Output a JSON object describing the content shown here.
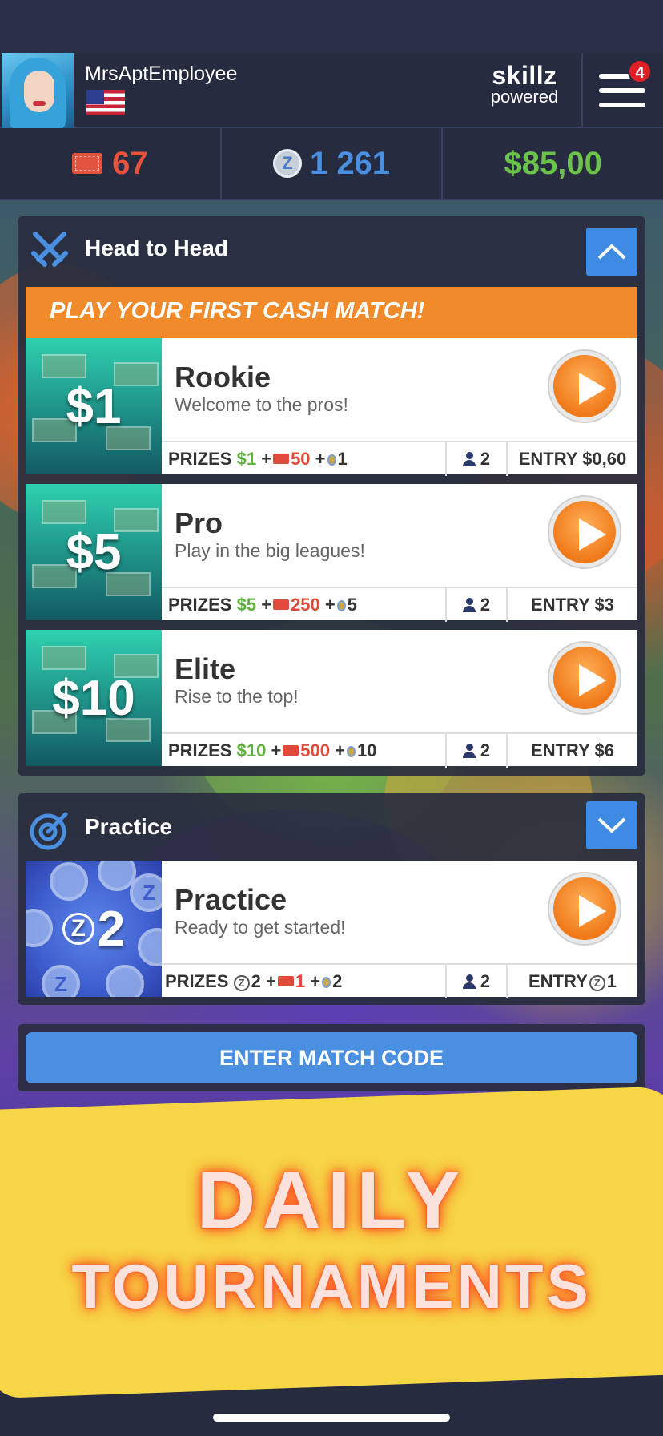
{
  "header": {
    "username": "MrsAptEmployee",
    "brand_top": "skillz",
    "brand_bottom": "powered",
    "notification_count": "4"
  },
  "currencies": {
    "tickets": "67",
    "z": "1 261",
    "cash": "$85,00"
  },
  "head_to_head": {
    "title": "Head to Head",
    "banner": "PLAY YOUR FIRST CASH MATCH!",
    "cards": [
      {
        "amount": "$1",
        "name": "Rookie",
        "desc": "Welcome to the pros!",
        "prize_cash": "$1",
        "prize_tickets": "50",
        "prize_medals": "1",
        "players": "2",
        "entry": "ENTRY $0,60"
      },
      {
        "amount": "$5",
        "name": "Pro",
        "desc": "Play in the big leagues!",
        "prize_cash": "$5",
        "prize_tickets": "250",
        "prize_medals": "5",
        "players": "2",
        "entry": "ENTRY $3"
      },
      {
        "amount": "$10",
        "name": "Elite",
        "desc": "Rise to the top!",
        "prize_cash": "$10",
        "prize_tickets": "500",
        "prize_medals": "10",
        "players": "2",
        "entry": "ENTRY $6"
      }
    ]
  },
  "practice": {
    "title": "Practice",
    "card": {
      "amount": "2",
      "name": "Practice",
      "desc": "Ready to get started!",
      "prize_z": "2",
      "prize_tickets": "1",
      "prize_medals": "2",
      "players": "2",
      "entry_label": "ENTRY",
      "entry_value": "1"
    }
  },
  "labels": {
    "prizes": "PRIZES",
    "plus": "+",
    "z_symbol": "Z",
    "enter_match_code": "ENTER MATCH CODE"
  },
  "promo": {
    "line1": "DAILY",
    "line2": "TOURNAMENTS"
  },
  "colors": {
    "accent_blue": "#4a8fe0",
    "play_orange": "#f07a1a",
    "banner_orange": "#f08a2a",
    "cash_green": "#6cc24a",
    "ticket_red": "#e5533c",
    "promo_yellow": "#f7d646"
  }
}
